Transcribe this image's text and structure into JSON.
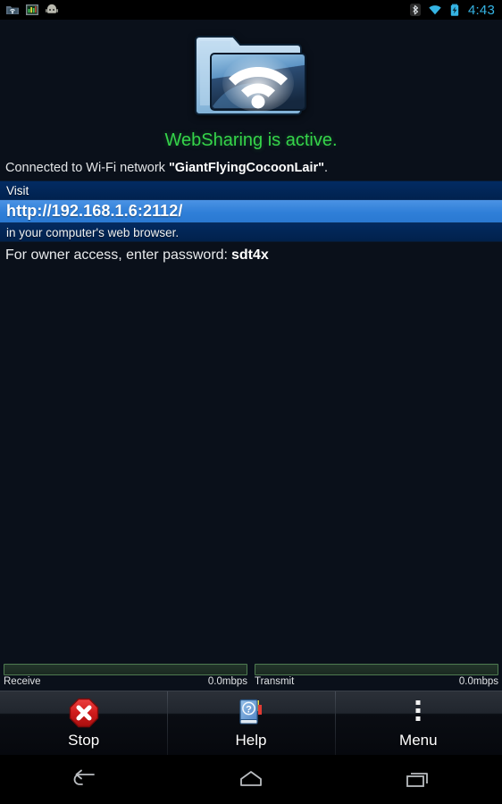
{
  "statusbar": {
    "left_icons": [
      {
        "name": "websharing-folder-notification-icon"
      },
      {
        "name": "bar-chart-notification-icon"
      },
      {
        "name": "android-robot-notification-icon"
      }
    ],
    "right_icons": [
      {
        "name": "bluetooth-icon"
      },
      {
        "name": "wifi-signal-icon"
      },
      {
        "name": "battery-charging-icon"
      }
    ],
    "clock": "4:43",
    "accent_color": "#35b4e4"
  },
  "main": {
    "app_icon_name": "websharing-folder-wifi-icon",
    "status_text": "WebSharing is active.",
    "status_color": "#35d44a",
    "connected_prefix": "Connected to Wi-Fi network ",
    "network_name": "\"GiantFlyingCocoonLair\"",
    "connected_suffix": ".",
    "visit_label": "Visit",
    "url": "http://192.168.1.6:2112/",
    "browser_label": "in your computer's web browser.",
    "password_prefix": "For owner access, enter password:",
    "password_value": "sdt4x",
    "url_band_color": "#2f7fd8",
    "band_color": "#022b63"
  },
  "transfer": {
    "bars": [
      {
        "label": "Receive",
        "rate": "0.0mbps",
        "percent": 0
      },
      {
        "label": "Transmit",
        "rate": "0.0mbps",
        "percent": 0
      }
    ],
    "bar_color": "#4e7a50"
  },
  "buttons": [
    {
      "label": "Stop",
      "icon": "stop-octagon-icon"
    },
    {
      "label": "Help",
      "icon": "help-book-icon"
    },
    {
      "label": "Menu",
      "icon": "overflow-dots-icon"
    }
  ],
  "navbar": [
    {
      "name": "back-button",
      "icon": "back-arrow-icon"
    },
    {
      "name": "home-button",
      "icon": "home-icon"
    },
    {
      "name": "recents-button",
      "icon": "recents-icon"
    }
  ]
}
